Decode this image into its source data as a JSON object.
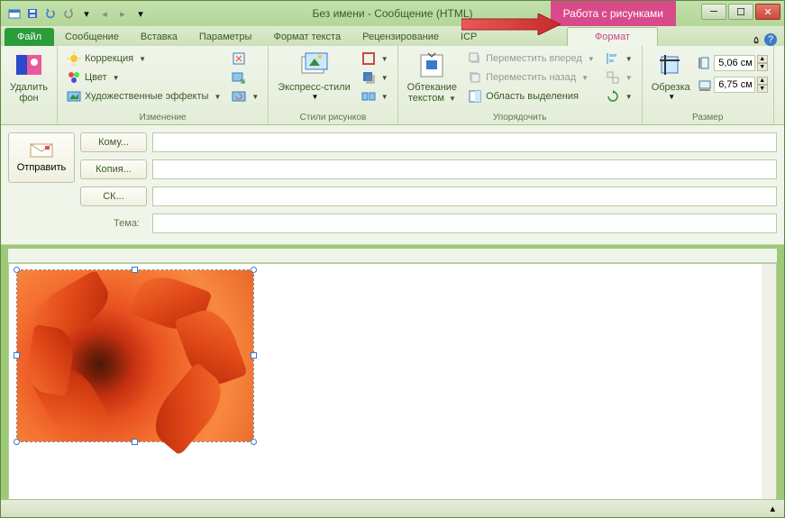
{
  "title": "Без имени  -  Сообщение (HTML)",
  "context_tab": "Работа с рисунками",
  "tabs": {
    "file": "Файл",
    "items": [
      "Сообщение",
      "Вставка",
      "Параметры",
      "Формат текста",
      "Рецензирование",
      "ICP"
    ],
    "format": "Формат"
  },
  "ribbon": {
    "remove_bg": {
      "l1": "Удалить",
      "l2": "фон"
    },
    "corrections": "Коррекция",
    "color": "Цвет",
    "artistic": "Художественные эффекты",
    "group_change": "Изменение",
    "quick_styles": "Экспресс-стили",
    "group_styles": "Стили рисунков",
    "wrap": {
      "l1": "Обтекание",
      "l2": "текстом"
    },
    "bring_fwd": "Переместить вперед",
    "send_back": "Переместить назад",
    "selection_pane": "Область выделения",
    "group_arrange": "Упорядочить",
    "crop": "Обрезка",
    "height": "5,06 см",
    "width": "6,75 см",
    "group_size": "Размер"
  },
  "mail": {
    "send": "Отправить",
    "to": "Кому...",
    "cc": "Копия...",
    "bcc": "СК...",
    "subject_label": "Тема:"
  }
}
